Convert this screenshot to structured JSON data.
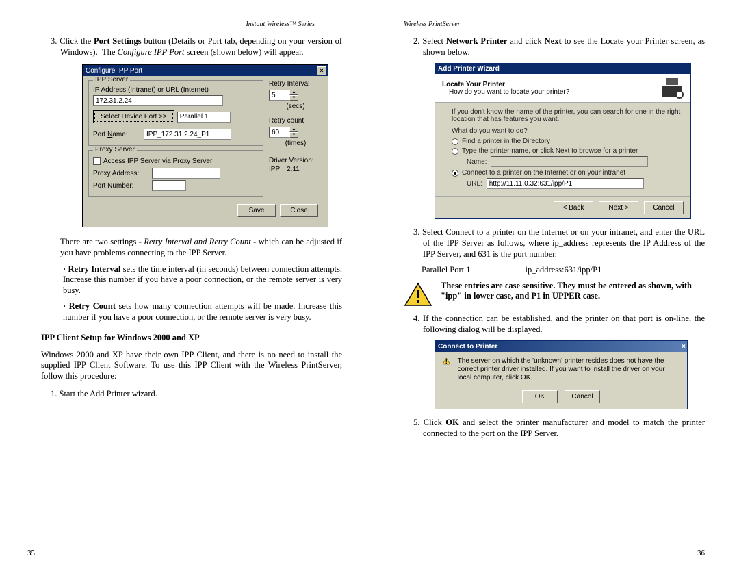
{
  "leftPage": {
    "header": "Instant Wireless™ Series",
    "pagenum": "35",
    "step3": "3. Click the Port Settings button (Details or Port tab, depending on your version of Windows).  The Configure IPP Port screen (shown below) will appear.",
    "afterDlg": "There are two settings - Retry Interval and Retry Count - which can be adjusted if you have problems connecting to the IPP Server.",
    "retryIntervalLabel": "Retry Interval",
    "retryIntervalText": " sets the time interval (in seconds) between connection attempts. Increase this number if you have a poor connection, or the remote server is very busy.",
    "retryCountLabel": "Retry Count",
    "retryCountText": " sets how many connection attempts will be made. Increase this number if you have a poor connection, or the remote server is very busy.",
    "heading": "IPP Client Setup for Windows 2000 and XP",
    "para2": "Windows 2000 and XP have their own IPP Client, and there is no need to install the supplied IPP Client Software. To use this IPP Client with the Wireless PrintServer, follow this procedure:",
    "step1b": "1. Start the Add Printer wizard."
  },
  "dlg1": {
    "title": "Configure IPP Port",
    "grp1": "IPP Server",
    "ipLabel": "IP Address (Intranet) or URL (Internet)",
    "ipVal": "172.31.2.24",
    "selectBtn": "Select Device Port >>",
    "parallel": "Parallel 1",
    "portNameLbl": "Port Name:",
    "portNameVal": "IPP_172.31.2.24_P1",
    "grp2": "Proxy Server",
    "proxyChk": "Access IPP Server via Proxy Server",
    "proxyAddr": "Proxy Address:",
    "proxyPort": "Port Number:",
    "retryInterval": "Retry Interval",
    "retryIntervalVal": "5",
    "secs": "(secs)",
    "retryCount": "Retry count",
    "retryCountVal": "60",
    "times": "(times)",
    "driverVer": "Driver Version:",
    "ipp": "IPP",
    "ippVer": "2.11",
    "save": "Save",
    "close": "Close"
  },
  "rightPage": {
    "header": "Wireless PrintServer",
    "pagenum": "36",
    "step2": "2. Select Network Printer and click Next to see the Locate your Printer screen, as shown below.",
    "step3": "3. Select Connect to a printer on the Internet or on your intranet, and enter the URL of the IPP Server as follows, where ip_address represents the IP Address of the IPP Server, and 631 is the port number.",
    "pp1": "Parallel Port 1",
    "pp1v": "ip_address:631/ipp/P1",
    "warn": "These entries are case sensitive. They must be entered as shown, with \"ipp\" in lower case, and P1 in UPPER case.",
    "step4": "4. If the connection can be established, and the printer on that port is on-line, the following dialog will be displayed.",
    "step5": "5. Click OK and select the printer manufacturer and model to match the printer connected to the port on the IPP Server."
  },
  "dlg2": {
    "title": "Add Printer Wizard",
    "head1": "Locate Your Printer",
    "head2": "How do you want to locate your printer?",
    "hint": "If you don't know the name of the printer, you can search for one in the right location that has features you want.",
    "q": "What do you want to do?",
    "opt1": "Find a printer in the Directory",
    "opt2": "Type the printer name, or click Next to browse for a printer",
    "nameLbl": "Name:",
    "opt3": "Connect to a printer on the Internet or on your intranet",
    "urlLbl": "URL:",
    "urlVal": "http://11.11.0.32:631/ipp/P1",
    "back": "< Back",
    "next": "Next >",
    "cancel": "Cancel"
  },
  "dlg3": {
    "title": "Connect to Printer",
    "msg": "The server on which the 'unknown' printer resides does not have the correct printer driver installed. If you want to install the driver on your local computer, click OK.",
    "ok": "OK",
    "cancel": "Cancel"
  }
}
